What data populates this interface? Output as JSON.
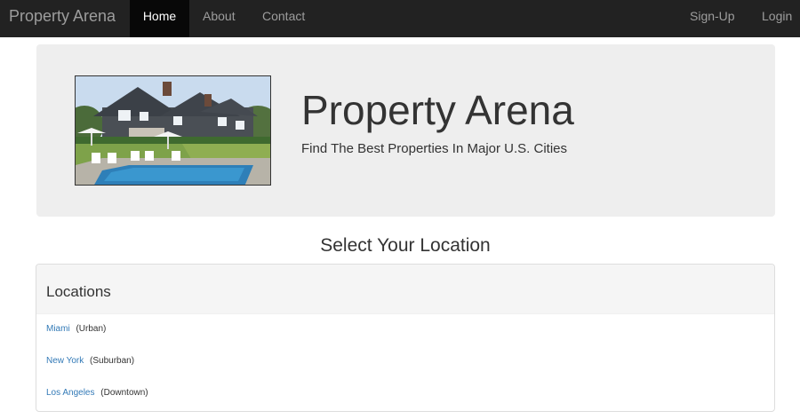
{
  "navbar": {
    "brand": "Property Arena",
    "items": [
      {
        "label": "Home",
        "active": true
      },
      {
        "label": "About",
        "active": false
      },
      {
        "label": "Contact",
        "active": false
      }
    ],
    "right_items": [
      {
        "label": "Sign-Up"
      },
      {
        "label": "Login"
      }
    ]
  },
  "hero": {
    "title": "Property Arena",
    "subtitle": "Find The Best Properties In Major U.S. Cities",
    "image_icon": "house-photo"
  },
  "section": {
    "heading": "Select Your Location"
  },
  "locations_panel": {
    "title": "Locations",
    "items": [
      {
        "city": "Miami",
        "type": "(Urban)"
      },
      {
        "city": "New York",
        "type": "(Suburban)"
      },
      {
        "city": "Los Angeles",
        "type": "(Downtown)"
      }
    ]
  },
  "colors": {
    "navbar_bg": "#222222",
    "navbar_active_bg": "#080808",
    "navbar_text": "#9d9d9d",
    "jumbotron_bg": "#eeeeee",
    "link": "#337ab7"
  }
}
